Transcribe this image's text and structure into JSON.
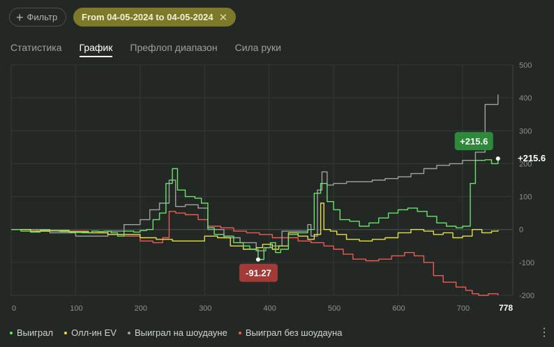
{
  "filter": {
    "label": "Фильтр",
    "icon": "plus-icon"
  },
  "date_chip": {
    "label": "From 04-05-2024 to 04-05-2024",
    "icon": "close-icon"
  },
  "tabs": [
    {
      "label": "Статистика",
      "active": false
    },
    {
      "label": "График",
      "active": true
    },
    {
      "label": "Префлоп диапазон",
      "active": false
    },
    {
      "label": "Сила руки",
      "active": false
    }
  ],
  "menu_icon": "more-vertical-icon",
  "chart_data": {
    "type": "line",
    "xlim": [
      0,
      778
    ],
    "ylim": [
      -200,
      500
    ],
    "x_ticks": [
      0,
      100,
      200,
      300,
      400,
      500,
      600,
      700
    ],
    "x_end_label": "778",
    "y_ticks": [
      500,
      400,
      300,
      200,
      100,
      0,
      -100,
      -200
    ],
    "grid": true,
    "legend_position": "bottom-left",
    "annotations": {
      "max_label": "+215.6",
      "max_point": [
        755,
        215.6
      ],
      "min_label": "-91.27",
      "min_point": [
        383,
        -91.27
      ],
      "end_label": "+215.6"
    },
    "series": [
      {
        "name": "Выиграл",
        "color": "#6be36b",
        "points": [
          [
            0,
            0
          ],
          [
            15,
            -5
          ],
          [
            30,
            -8
          ],
          [
            45,
            -2
          ],
          [
            60,
            -3
          ],
          [
            75,
            -6
          ],
          [
            90,
            -9
          ],
          [
            110,
            -10
          ],
          [
            125,
            -5
          ],
          [
            135,
            -6
          ],
          [
            145,
            -5
          ],
          [
            155,
            -10
          ],
          [
            165,
            -20
          ],
          [
            175,
            -5
          ],
          [
            190,
            -8
          ],
          [
            200,
            -3
          ],
          [
            210,
            0
          ],
          [
            220,
            30
          ],
          [
            230,
            50
          ],
          [
            240,
            140
          ],
          [
            250,
            185
          ],
          [
            258,
            120
          ],
          [
            270,
            100
          ],
          [
            285,
            95
          ],
          [
            295,
            80
          ],
          [
            305,
            5
          ],
          [
            315,
            -15
          ],
          [
            330,
            -20
          ],
          [
            345,
            -40
          ],
          [
            360,
            -50
          ],
          [
            370,
            -60
          ],
          [
            383,
            -91
          ],
          [
            392,
            -55
          ],
          [
            402,
            -40
          ],
          [
            410,
            -70
          ],
          [
            418,
            -60
          ],
          [
            430,
            -15
          ],
          [
            445,
            -10
          ],
          [
            460,
            0
          ],
          [
            470,
            110
          ],
          [
            480,
            140
          ],
          [
            490,
            85
          ],
          [
            500,
            60
          ],
          [
            510,
            30
          ],
          [
            525,
            25
          ],
          [
            540,
            10
          ],
          [
            555,
            20
          ],
          [
            570,
            35
          ],
          [
            585,
            50
          ],
          [
            600,
            60
          ],
          [
            615,
            65
          ],
          [
            630,
            55
          ],
          [
            645,
            40
          ],
          [
            660,
            20
          ],
          [
            675,
            10
          ],
          [
            690,
            5
          ],
          [
            700,
            10
          ],
          [
            712,
            140
          ],
          [
            720,
            210
          ],
          [
            735,
            212
          ],
          [
            745,
            200
          ],
          [
            755,
            215.6
          ]
        ]
      },
      {
        "name": "Олл-ин EV",
        "color": "#e6de4a",
        "points": [
          [
            0,
            0
          ],
          [
            30,
            -5
          ],
          [
            60,
            -3
          ],
          [
            90,
            -7
          ],
          [
            120,
            -10
          ],
          [
            150,
            -15
          ],
          [
            175,
            -15
          ],
          [
            200,
            -25
          ],
          [
            225,
            -30
          ],
          [
            250,
            -35
          ],
          [
            275,
            -35
          ],
          [
            300,
            -20
          ],
          [
            320,
            -25
          ],
          [
            340,
            -50
          ],
          [
            360,
            -60
          ],
          [
            380,
            -55
          ],
          [
            390,
            -45
          ],
          [
            405,
            -60
          ],
          [
            415,
            -50
          ],
          [
            430,
            -10
          ],
          [
            445,
            -20
          ],
          [
            460,
            -30
          ],
          [
            470,
            -15
          ],
          [
            480,
            80
          ],
          [
            485,
            0
          ],
          [
            495,
            -5
          ],
          [
            505,
            -15
          ],
          [
            520,
            -30
          ],
          [
            540,
            -35
          ],
          [
            560,
            -30
          ],
          [
            580,
            -25
          ],
          [
            600,
            -10
          ],
          [
            620,
            0
          ],
          [
            640,
            -5
          ],
          [
            655,
            -15
          ],
          [
            670,
            -10
          ],
          [
            685,
            -25
          ],
          [
            700,
            -20
          ],
          [
            715,
            0
          ],
          [
            730,
            -10
          ],
          [
            745,
            -5
          ],
          [
            755,
            -2
          ]
        ]
      },
      {
        "name": "Выиграл на шоудауне",
        "color": "#9fa39f",
        "points": [
          [
            0,
            0
          ],
          [
            60,
            -10
          ],
          [
            100,
            -20
          ],
          [
            150,
            -5
          ],
          [
            175,
            15
          ],
          [
            200,
            30
          ],
          [
            215,
            60
          ],
          [
            230,
            80
          ],
          [
            245,
            150
          ],
          [
            255,
            70
          ],
          [
            270,
            75
          ],
          [
            290,
            65
          ],
          [
            305,
            0
          ],
          [
            330,
            -25
          ],
          [
            355,
            -40
          ],
          [
            380,
            -65
          ],
          [
            395,
            -55
          ],
          [
            405,
            -50
          ],
          [
            420,
            -5
          ],
          [
            440,
            -5
          ],
          [
            460,
            15
          ],
          [
            465,
            -20
          ],
          [
            475,
            120
          ],
          [
            482,
            175
          ],
          [
            490,
            135
          ],
          [
            500,
            140
          ],
          [
            520,
            145
          ],
          [
            540,
            145
          ],
          [
            560,
            150
          ],
          [
            580,
            155
          ],
          [
            600,
            160
          ],
          [
            620,
            170
          ],
          [
            640,
            185
          ],
          [
            660,
            195
          ],
          [
            680,
            200
          ],
          [
            700,
            210
          ],
          [
            720,
            235
          ],
          [
            735,
            380
          ],
          [
            750,
            380
          ],
          [
            755,
            410
          ]
        ]
      },
      {
        "name": "Выиграл без шоудауна",
        "color": "#ee5b55",
        "points": [
          [
            0,
            0
          ],
          [
            40,
            -5
          ],
          [
            80,
            -5
          ],
          [
            120,
            -10
          ],
          [
            150,
            -15
          ],
          [
            175,
            -20
          ],
          [
            200,
            -35
          ],
          [
            220,
            -40
          ],
          [
            235,
            -25
          ],
          [
            245,
            55
          ],
          [
            255,
            50
          ],
          [
            270,
            45
          ],
          [
            290,
            30
          ],
          [
            305,
            10
          ],
          [
            325,
            5
          ],
          [
            345,
            -5
          ],
          [
            365,
            -10
          ],
          [
            385,
            -15
          ],
          [
            405,
            -25
          ],
          [
            425,
            -25
          ],
          [
            445,
            -35
          ],
          [
            465,
            -40
          ],
          [
            485,
            -50
          ],
          [
            500,
            -60
          ],
          [
            515,
            -75
          ],
          [
            530,
            -90
          ],
          [
            550,
            -95
          ],
          [
            570,
            -90
          ],
          [
            590,
            -80
          ],
          [
            610,
            -70
          ],
          [
            625,
            -80
          ],
          [
            640,
            -100
          ],
          [
            655,
            -140
          ],
          [
            670,
            -160
          ],
          [
            690,
            -175
          ],
          [
            705,
            -185
          ],
          [
            715,
            -195
          ],
          [
            725,
            -200
          ],
          [
            740,
            -195
          ],
          [
            755,
            -200
          ]
        ]
      }
    ]
  }
}
